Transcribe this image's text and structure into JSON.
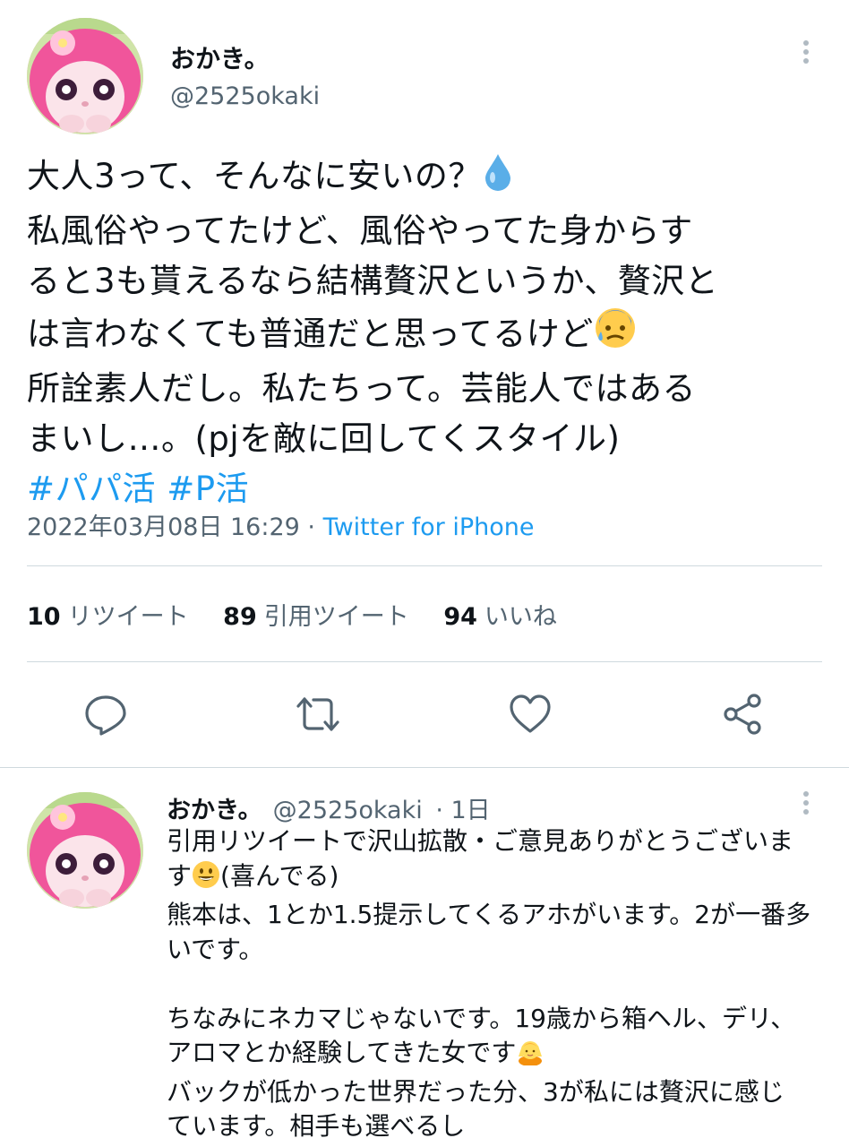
{
  "tweet": {
    "author": {
      "display_name": "おかき。",
      "handle": "@2525okaki",
      "avatar_icon": "avatar-character-icon"
    },
    "text_lines": [
      "大人3って、そんなに安いの？",
      "私風俗やってたけど、風俗やってた身からす",
      "ると3も貰えるなら結構贅沢というか、贅沢と",
      "は言わなくても普通だと思ってるけど",
      "所詮素人だし。私たちって。芸能人ではある",
      "まいし…。(pjを敵に回してくスタイル)"
    ],
    "hashtags": [
      "#パパ活",
      "#P活"
    ],
    "timestamp": "2022年03月08日 16:29",
    "separator": " · ",
    "source": "Twitter for iPhone",
    "stats": {
      "retweets_count": "10",
      "retweets_label": "リツイート",
      "quotes_count": "89",
      "quotes_label": "引用ツイート",
      "likes_count": "94",
      "likes_label": "いいね"
    },
    "actions": [
      "reply-icon",
      "retweet-icon",
      "like-icon",
      "share-icon"
    ]
  },
  "reply": {
    "display_name": "おかき。",
    "handle": "@2525okaki",
    "time": "· 1日",
    "text_lines": [
      "引用リツイートで沢山拡散・ご意見ありがとうございま",
      "す",
      "(喜んでる)",
      "熊本は、1とか1.5提示してくるアホがいます。2が一番多",
      "いです。",
      "",
      "ちなみにネカマじゃないです。19歳から箱ヘル、デリ、",
      "アロマとか経験してきた女です",
      "バックが低かった世界だった分、3が私には贅沢に感じ",
      "ています。相手も選べるし"
    ]
  },
  "colors": {
    "accent": "#1d9bf0",
    "secondary_text": "#536471",
    "divider": "#cfd9de"
  }
}
